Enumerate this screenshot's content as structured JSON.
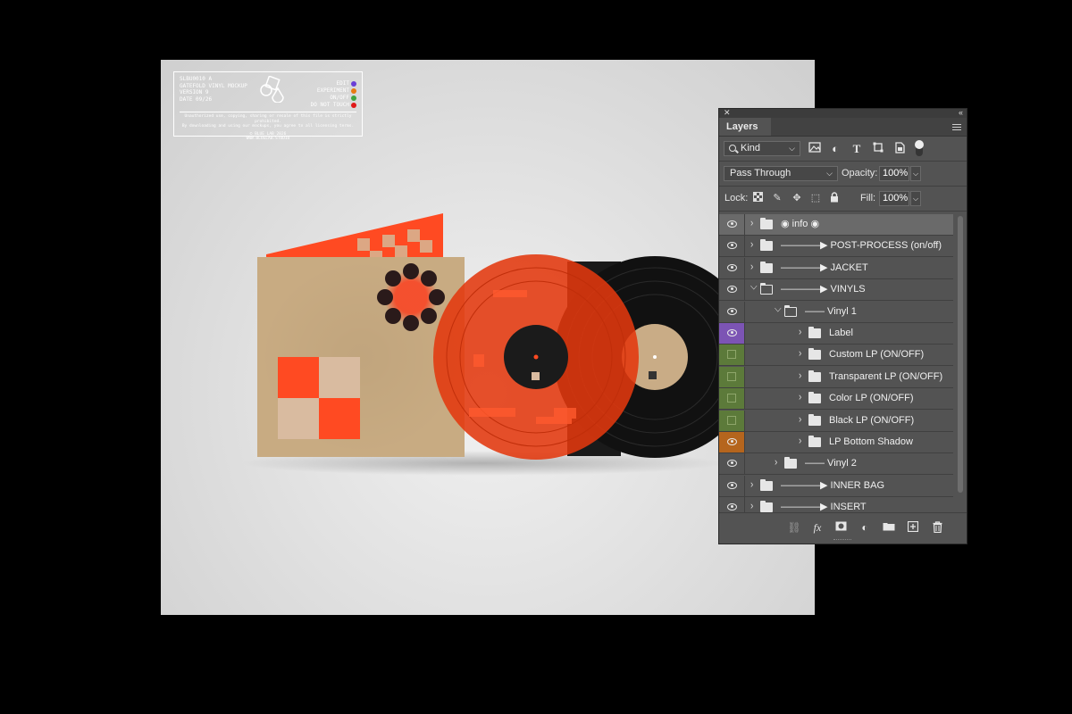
{
  "info_card": {
    "lines": [
      "SLBU0010 A",
      "GATEFOLD VINYL MOCKUP",
      "VERSION 9",
      "DATE 09/26"
    ],
    "legend": [
      {
        "label": "EDIT",
        "color": "#6a3fd6"
      },
      {
        "label": "EXPERIMENT",
        "color": "#e87a12"
      },
      {
        "label": "ON/OFF",
        "color": "#3fa33f"
      },
      {
        "label": "DO NOT TOUCH",
        "color": "#e01818"
      }
    ],
    "notice_1": "Unauthorized use, copying, sharing or resale of this file is strictly prohibited.",
    "notice_2": "By downloading and using our mockups, you agree to all licensing terms.",
    "copyright": "© BLUE LAB 2026",
    "site": "WWW.BLUELAB.STUDIO"
  },
  "panel": {
    "title": "Layers",
    "close": "✕",
    "collapse": "‹‹",
    "filter_kind": "Kind",
    "blend_mode": "Pass Through",
    "opacity_label": "Opacity:",
    "opacity_value": "100%",
    "lock_label": "Lock:",
    "fill_label": "Fill:",
    "fill_value": "100%",
    "fx_label": "fx"
  },
  "layers": [
    {
      "name": "◉ info ◉",
      "vis": "eye",
      "vis_color": "",
      "indent": 0,
      "open": false,
      "selected": true
    },
    {
      "name": "————▶ POST-PROCESS (on/off)",
      "vis": "eye",
      "vis_color": "",
      "indent": 0,
      "open": false,
      "selected": false
    },
    {
      "name": "————▶ JACKET",
      "vis": "eye",
      "vis_color": "",
      "indent": 0,
      "open": false,
      "selected": false
    },
    {
      "name": "————▶ VINYLS",
      "vis": "eye",
      "vis_color": "",
      "indent": 0,
      "open": true,
      "selected": false
    },
    {
      "name": "—— Vinyl 1",
      "vis": "eye",
      "vis_color": "",
      "indent": 1,
      "open": true,
      "selected": false
    },
    {
      "name": "Label",
      "vis": "eye",
      "vis_color": "#7c54b4",
      "indent": 2,
      "open": false,
      "selected": false
    },
    {
      "name": "Custom LP (ON/OFF)",
      "vis": "box",
      "vis_color": "#5c7a3a",
      "indent": 2,
      "open": false,
      "selected": false
    },
    {
      "name": "Transparent LP (ON/OFF)",
      "vis": "box",
      "vis_color": "#5c7a3a",
      "indent": 2,
      "open": false,
      "selected": false
    },
    {
      "name": "Color LP (ON/OFF)",
      "vis": "box",
      "vis_color": "#5c7a3a",
      "indent": 2,
      "open": false,
      "selected": false
    },
    {
      "name": "Black LP (ON/OFF)",
      "vis": "box",
      "vis_color": "#5c7a3a",
      "indent": 2,
      "open": false,
      "selected": false
    },
    {
      "name": "LP Bottom Shadow",
      "vis": "eye",
      "vis_color": "#b5651d",
      "indent": 2,
      "open": false,
      "selected": false
    },
    {
      "name": "—— Vinyl 2",
      "vis": "eye",
      "vis_color": "",
      "indent": 1,
      "open": false,
      "selected": false
    },
    {
      "name": "————▶ INNER BAG",
      "vis": "eye",
      "vis_color": "",
      "indent": 0,
      "open": false,
      "selected": false
    },
    {
      "name": "————▶ INSERT",
      "vis": "eye",
      "vis_color": "",
      "indent": 0,
      "open": false,
      "selected": false
    }
  ]
}
